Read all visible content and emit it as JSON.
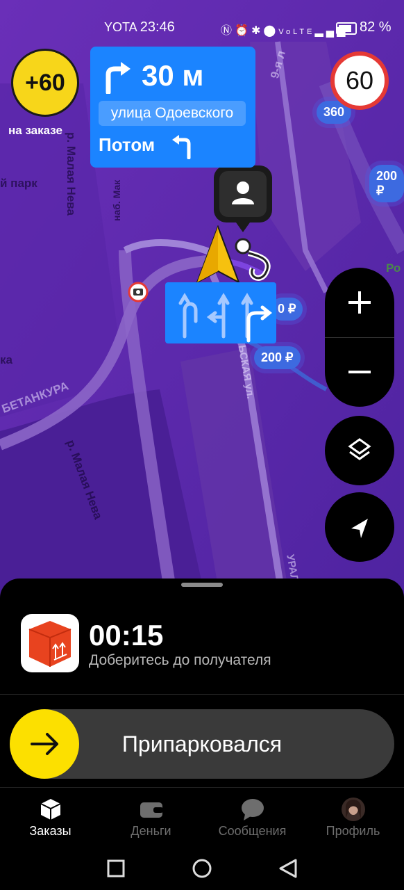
{
  "status_bar": {
    "carrier": "YOTA",
    "time": "23:46",
    "battery_percent": "82 %",
    "icons": [
      "nfc-icon",
      "alarm-icon",
      "bluetooth-icon",
      "location-icon",
      "volte-icon",
      "signal-icon",
      "battery-icon"
    ]
  },
  "bonus": {
    "value": "+60",
    "caption": "на заказе"
  },
  "speed_limit": "60",
  "navigation": {
    "distance": "30 м",
    "street": "улица Одоевского",
    "then_label": "Потом"
  },
  "map": {
    "labels": {
      "park": "й парк",
      "river_top": "р. Малая Нева",
      "embankment": "наб. Мак",
      "street_9": "9-я л",
      "betankura": "БЕТАНКУРА",
      "river_bottom": "р. Малая Нева",
      "street_v": "ЬСКАЯ ул.",
      "ka": "ка",
      "ro": "Ро",
      "ural": "УРАЛ"
    },
    "prices": {
      "p1": "360",
      "p2": "200 ₽",
      "p3": "0 ₽",
      "p4": "200 ₽"
    }
  },
  "order": {
    "timer": "00:15",
    "subtitle": "Доберитесь до получателя",
    "slider_label": "Припарковался"
  },
  "tabs": [
    {
      "label": "Заказы",
      "icon": "cube-icon",
      "active": true
    },
    {
      "label": "Деньги",
      "icon": "wallet-icon",
      "active": false
    },
    {
      "label": "Сообщения",
      "icon": "chat-icon",
      "active": false
    },
    {
      "label": "Профиль",
      "icon": "avatar",
      "active": false
    }
  ],
  "colors": {
    "accent_yellow": "#fce000",
    "nav_blue": "#1b84ff",
    "speed_red": "#e53935",
    "map_purple": "#5b2aa8"
  }
}
